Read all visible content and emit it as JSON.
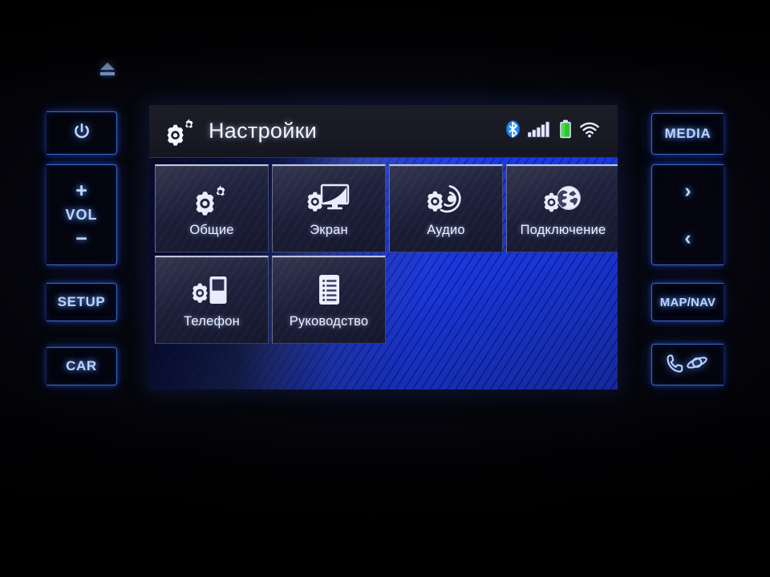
{
  "device": {
    "type": "car-infotainment-head-unit",
    "screen_title": "Настройки"
  },
  "header": {
    "title": "Настройки",
    "icon": "gears-icon"
  },
  "status_bar": {
    "items": [
      {
        "name": "bluetooth-icon",
        "label": "Bluetooth",
        "color": "#1e7fe8",
        "state": "connected"
      },
      {
        "name": "signal-bars-icon",
        "label": "Signal",
        "color": "#e8ecff",
        "bars": 5
      },
      {
        "name": "battery-icon",
        "label": "Battery",
        "color": "#36d13a",
        "level": 90
      },
      {
        "name": "wifi-icon",
        "label": "Wi-Fi",
        "color": "#dfe6ff",
        "state": "connected"
      }
    ]
  },
  "menu": {
    "tiles": [
      {
        "id": "general",
        "label": "Общие",
        "icon": "gears-icon"
      },
      {
        "id": "display",
        "label": "Экран",
        "icon": "monitor-gear-icon"
      },
      {
        "id": "audio",
        "label": "Аудио",
        "icon": "audio-gear-icon"
      },
      {
        "id": "connection",
        "label": "Подключение",
        "icon": "globe-gear-icon"
      },
      {
        "id": "phone",
        "label": "Телефон",
        "icon": "phone-gear-icon"
      },
      {
        "id": "manual",
        "label": "Руководство",
        "icon": "document-list-icon"
      }
    ]
  },
  "hardware_buttons": {
    "left": [
      {
        "id": "eject",
        "label": "",
        "icon": "eject-icon"
      },
      {
        "id": "power",
        "label": "",
        "icon": "power-icon"
      },
      {
        "id": "volume",
        "plus": "+",
        "label": "VOL",
        "minus": "−",
        "icon": "volume-rocker"
      },
      {
        "id": "setup",
        "label": "SETUP",
        "icon": ""
      },
      {
        "id": "car",
        "label": "CAR",
        "icon": ""
      }
    ],
    "right": [
      {
        "id": "media",
        "label": "MEDIA",
        "icon": ""
      },
      {
        "id": "seek",
        "next": "›",
        "prev": "‹",
        "label": "",
        "icon": "seek-rocker"
      },
      {
        "id": "map-nav",
        "label": "MAP/NAV",
        "icon": ""
      },
      {
        "id": "phone-voice",
        "label": "",
        "icon": "phone-voice-icon"
      }
    ]
  },
  "colors": {
    "button_glow": "#4f82ff",
    "button_text": "#bcd4ff",
    "screen_blue": "#1433e6",
    "titlebar": "#1a1b25",
    "tile_fill": "#222540",
    "bluetooth": "#1e7fe8",
    "battery_green": "#36d13a"
  }
}
